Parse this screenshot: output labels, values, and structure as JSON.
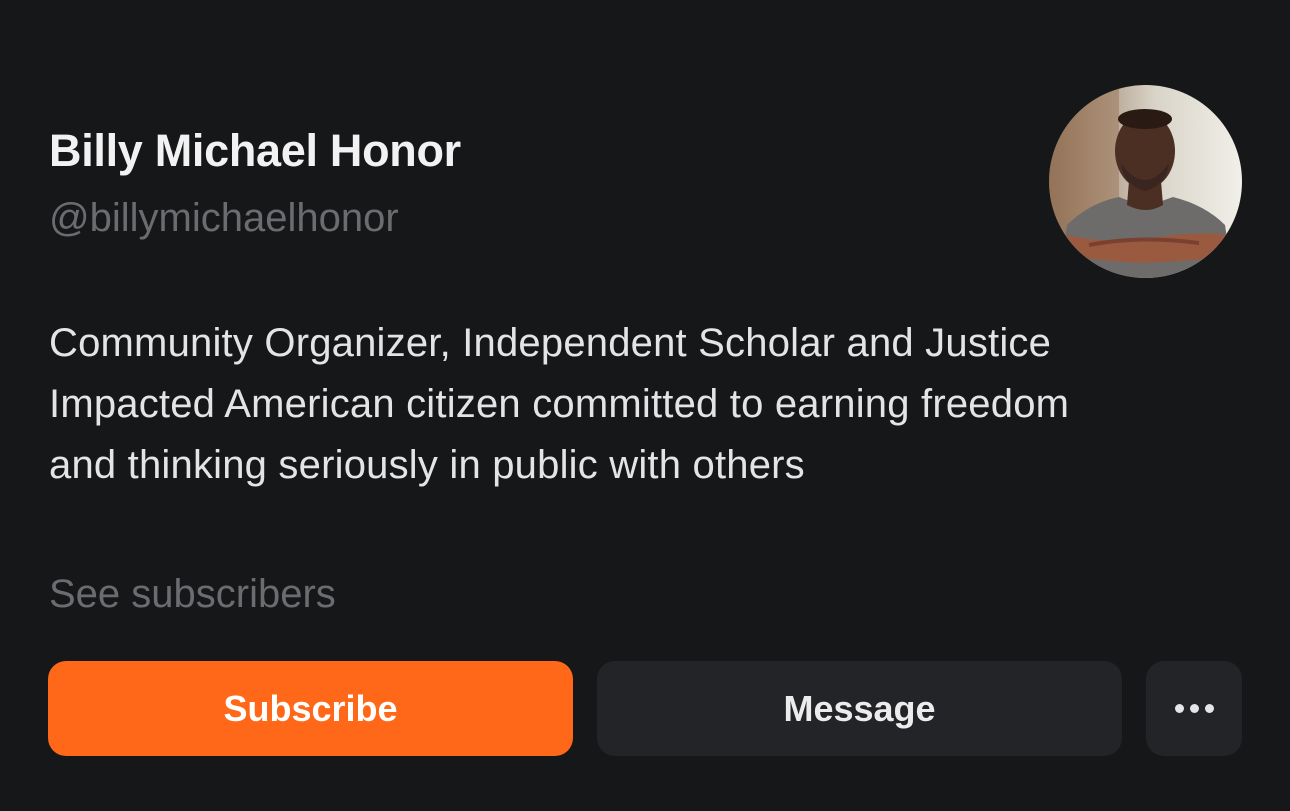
{
  "profile": {
    "name": "Billy Michael Honor",
    "handle": "@billymichaelhonor",
    "bio_lines": [
      "Community Organizer, Independent Scholar and Justice",
      "Impacted American citizen committed to earning freedom",
      "and thinking seriously in public with others"
    ],
    "see_subscribers_label": "See subscribers",
    "avatar_icon": "profile-photo"
  },
  "actions": {
    "subscribe_label": "Subscribe",
    "message_label": "Message",
    "more_icon": "more-horizontal-icon"
  },
  "colors": {
    "background": "#161719",
    "accent": "#ff6719",
    "secondary_button": "#232427",
    "muted_text": "#6a6c70"
  }
}
